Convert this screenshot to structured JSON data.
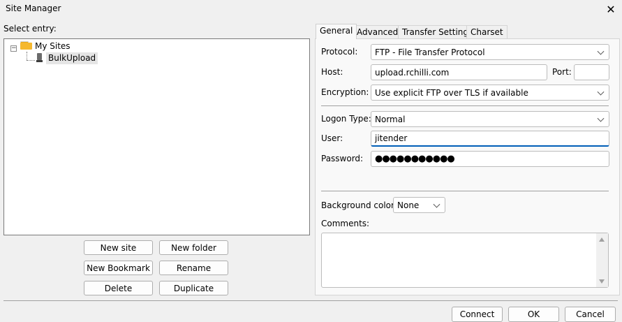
{
  "window": {
    "title": "Site Manager"
  },
  "left": {
    "select_entry_label": "Select entry:",
    "tree": {
      "root": {
        "label": "My Sites",
        "expander": "−"
      },
      "items": [
        {
          "label": "BulkUpload"
        }
      ]
    },
    "buttons": {
      "new_site": "New site",
      "new_folder": "New folder",
      "new_bookmark": "New Bookmark",
      "rename": "Rename",
      "delete": "Delete",
      "duplicate": "Duplicate"
    }
  },
  "tabs": [
    {
      "label": "General",
      "active": true
    },
    {
      "label": "Advanced",
      "active": false
    },
    {
      "label": "Transfer Settings",
      "active": false
    },
    {
      "label": "Charset",
      "active": false
    }
  ],
  "general": {
    "protocol": {
      "label": "Protocol:",
      "value": "FTP - File Transfer Protocol"
    },
    "host": {
      "label": "Host:",
      "value": "upload.rchilli.com"
    },
    "port": {
      "label": "Port:",
      "value": ""
    },
    "encryption": {
      "label": "Encryption:",
      "value": "Use explicit FTP over TLS if available"
    },
    "logon_type": {
      "label": "Logon Type:",
      "value": "Normal"
    },
    "user": {
      "label": "User:",
      "value": "jitender"
    },
    "password": {
      "label": "Password:",
      "value": "●●●●●●●●●●●"
    },
    "background_color": {
      "label": "Background color:",
      "value": "None"
    },
    "comments": {
      "label": "Comments:",
      "value": ""
    }
  },
  "footer": {
    "connect": "Connect",
    "ok": "OK",
    "cancel": "Cancel"
  },
  "colors": {
    "window_bg": "#f0f0f0",
    "panel_bg": "#f9f9f9",
    "focus_accent": "#005fb8",
    "folder": "#f5b82e"
  }
}
